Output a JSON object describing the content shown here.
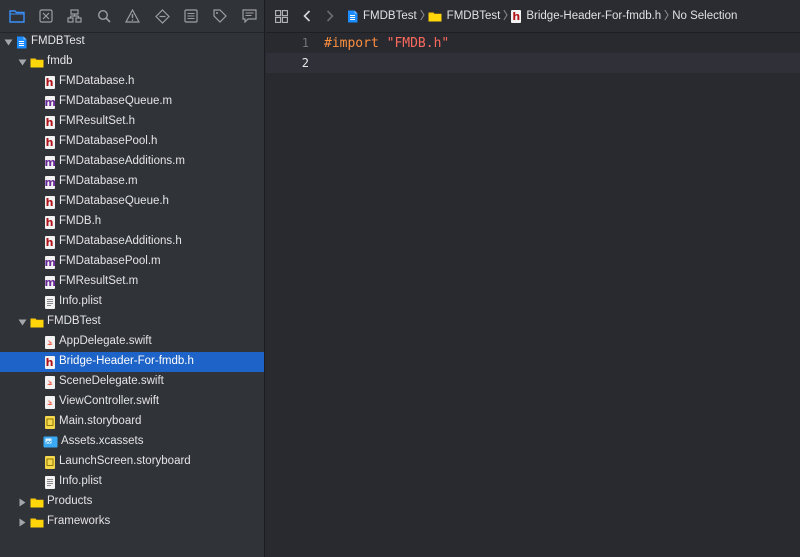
{
  "navigator": {
    "toolbar_icons": [
      "folder-icon",
      "source-control-icon",
      "hierarchy-icon",
      "search-icon",
      "warning-icon",
      "test-diamond-icon",
      "list-icon",
      "tag-icon",
      "comment-icon"
    ],
    "tree": [
      {
        "label": "FMDBTest",
        "icon": "project",
        "indent": 0,
        "disclosure": "open"
      },
      {
        "label": "fmdb",
        "icon": "folder",
        "indent": 1,
        "disclosure": "open"
      },
      {
        "label": "FMDatabase.h",
        "icon": "h",
        "indent": 2
      },
      {
        "label": "FMDatabaseQueue.m",
        "icon": "m",
        "indent": 2
      },
      {
        "label": "FMResultSet.h",
        "icon": "h",
        "indent": 2
      },
      {
        "label": "FMDatabasePool.h",
        "icon": "h",
        "indent": 2
      },
      {
        "label": "FMDatabaseAdditions.m",
        "icon": "m",
        "indent": 2
      },
      {
        "label": "FMDatabase.m",
        "icon": "m",
        "indent": 2
      },
      {
        "label": "FMDatabaseQueue.h",
        "icon": "h",
        "indent": 2
      },
      {
        "label": "FMDB.h",
        "icon": "h",
        "indent": 2
      },
      {
        "label": "FMDatabaseAdditions.h",
        "icon": "h",
        "indent": 2
      },
      {
        "label": "FMDatabasePool.m",
        "icon": "m",
        "indent": 2
      },
      {
        "label": "FMResultSet.m",
        "icon": "m",
        "indent": 2
      },
      {
        "label": "Info.plist",
        "icon": "plist",
        "indent": 2
      },
      {
        "label": "FMDBTest",
        "icon": "folder",
        "indent": 1,
        "disclosure": "open"
      },
      {
        "label": "AppDelegate.swift",
        "icon": "swift",
        "indent": 2
      },
      {
        "label": "Bridge-Header-For-fmdb.h",
        "icon": "h",
        "indent": 2,
        "selected": true
      },
      {
        "label": "SceneDelegate.swift",
        "icon": "swift",
        "indent": 2
      },
      {
        "label": "ViewController.swift",
        "icon": "swift",
        "indent": 2
      },
      {
        "label": "Main.storyboard",
        "icon": "storyboard",
        "indent": 2
      },
      {
        "label": "Assets.xcassets",
        "icon": "assets",
        "indent": 2
      },
      {
        "label": "LaunchScreen.storyboard",
        "icon": "storyboard",
        "indent": 2
      },
      {
        "label": "Info.plist",
        "icon": "plist",
        "indent": 2
      },
      {
        "label": "Products",
        "icon": "folder",
        "indent": 1,
        "disclosure": "closed"
      },
      {
        "label": "Frameworks",
        "icon": "folder",
        "indent": 1,
        "disclosure": "closed"
      }
    ]
  },
  "editor": {
    "breadcrumb": [
      {
        "label": "FMDBTest",
        "icon": "project"
      },
      {
        "label": "FMDBTest",
        "icon": "folder"
      },
      {
        "label": "Bridge-Header-For-fmdb.h",
        "icon": "h"
      },
      {
        "label": "No Selection",
        "icon": ""
      }
    ],
    "lines": [
      {
        "num": "1",
        "keyword": "#import",
        "string": "\"FMDB.h\""
      },
      {
        "num": "2",
        "keyword": "",
        "string": ""
      }
    ],
    "current_line": "2"
  },
  "colors": {
    "selection": "#1e63c7",
    "folder": "#f7c900",
    "header_icon": "#b2121a",
    "impl_icon": "#6a2a9a",
    "swift": "#f05138",
    "keyword": "#fd8f3f",
    "string": "#fc6a5d"
  }
}
